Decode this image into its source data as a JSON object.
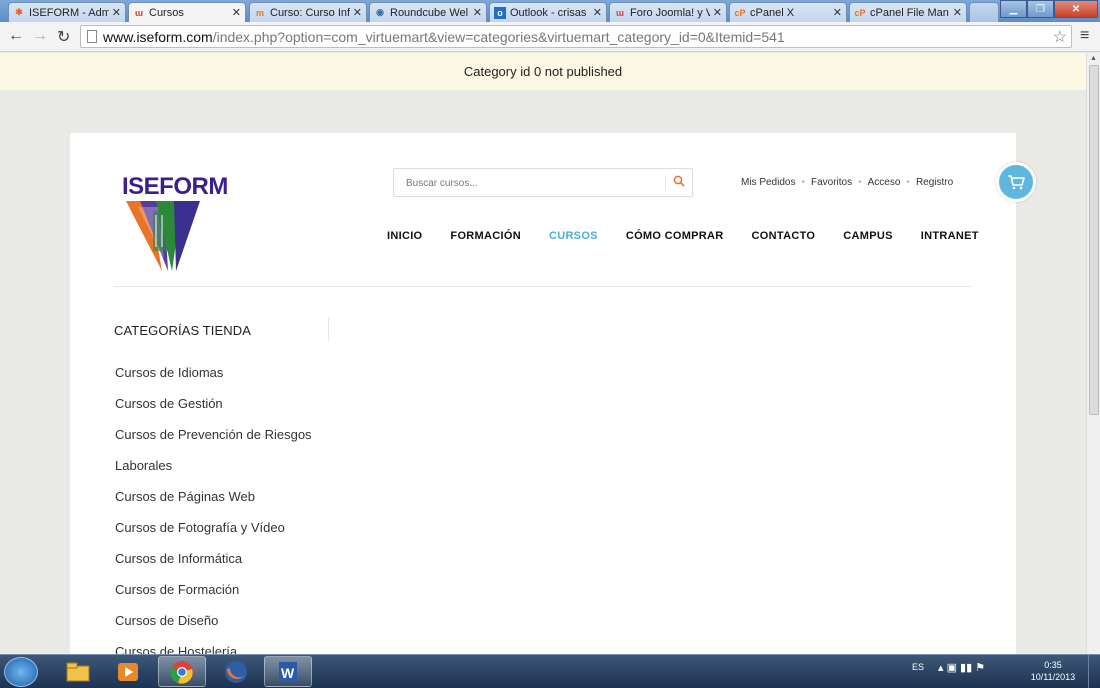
{
  "browser": {
    "tabs": [
      {
        "title": "ISEFORM - Adm",
        "favicon": "joomla-icon",
        "active": false
      },
      {
        "title": "Cursos",
        "favicon": "w-icon",
        "active": true
      },
      {
        "title": "Curso: Curso Inf",
        "favicon": "moodle-icon",
        "active": false
      },
      {
        "title": "Roundcube Wel",
        "favicon": "roundcube-icon",
        "active": false
      },
      {
        "title": "Outlook - crisas",
        "favicon": "outlook-icon",
        "active": false
      },
      {
        "title": "Foro Joomla! y V",
        "favicon": "w-icon",
        "active": false
      },
      {
        "title": "cPanel X",
        "favicon": "cpanel-icon",
        "active": false
      },
      {
        "title": "cPanel File Man",
        "favicon": "cpanel-icon",
        "active": false
      }
    ],
    "url_host": "www.iseform.com",
    "url_path": "/index.php?option=com_virtuemart&view=categories&virtuemart_category_id=0&Itemid=541"
  },
  "notice": {
    "message": "Category id 0 not published"
  },
  "site": {
    "logo_text": "ISEFORM",
    "search_placeholder": "Buscar cursos...",
    "top_links": [
      "Mis Pedidos",
      "Favoritos",
      "Acceso",
      "Registro"
    ],
    "nav": [
      {
        "label": "INICIO",
        "active": false
      },
      {
        "label": "FORMACIÓN",
        "active": false
      },
      {
        "label": "CURSOS",
        "active": true
      },
      {
        "label": "CÓMO COMPRAR",
        "active": false
      },
      {
        "label": "CONTACTO",
        "active": false
      },
      {
        "label": "CAMPUS",
        "active": false
      },
      {
        "label": "INTRANET",
        "active": false
      }
    ],
    "categories_title": "CATEGORÍAS TIENDA",
    "categories": [
      "Cursos de Idiomas",
      "Cursos de Gestión",
      "Cursos de Prevención de Riesgos",
      "Laborales",
      "Cursos de Páginas Web",
      "Cursos de Fotografía y Vídeo",
      "Cursos de Informática",
      "Cursos de Formación",
      "Cursos de Diseño",
      "Cursos de Hostelería"
    ],
    "accent_color": "#4aaed6",
    "cart_color": "#5fb7dd"
  },
  "taskbar": {
    "language": "ES",
    "time": "0:35",
    "date": "10/11/2013",
    "apps": [
      "explorer-icon",
      "media-player-icon",
      "chrome-icon",
      "firefox-icon",
      "word-icon"
    ]
  }
}
